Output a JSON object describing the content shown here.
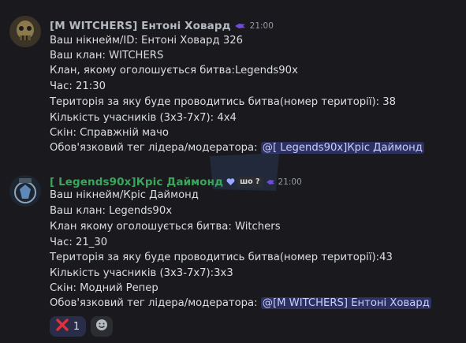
{
  "messages": [
    {
      "username": "[M WITCHERS] Ентоні Ховард",
      "username_color": "#b5bac1",
      "time": "21:00",
      "lines": [
        "Ваш нікнейм/ID: Ентоні Ховард 326",
        "Ваш клан: WITCHERS",
        "Клан, якому оголошується битва:Legends90x",
        "Час: 21:30",
        "Територія за яку буде проводитись битва(номер території): 38",
        "Кількість учасників (3х3-7х7): 4х4",
        "Скін:  Справжній мачо"
      ],
      "tag_line": {
        "prefix": "Обов'язковий тег лідера/модератора: ",
        "mention": "@[ Legends90x]Кріс Даймонд"
      }
    },
    {
      "username": "[ Legends90x]Кріс Даймонд",
      "username_color": "#3ba55c",
      "role_pill": "шо ?",
      "time": "21:00",
      "lines": [
        "Ваш нікнейм/Кріс Даймонд",
        "Ваш клан: Legends90x",
        "Клан якому оголошується битва: Witchers",
        "Час: 21_30",
        "Територія за яку буде проводитись битва(номер території):43",
        "Кількість учасників (3х3-7х7):3х3",
        "Скін: Модний Репер"
      ],
      "tag_line": {
        "prefix": "Обов'язковий тег лідера/модератора: ",
        "mention": "@[M WITCHERS] Ентоні Ховард"
      }
    }
  ],
  "reactions": [
    {
      "emoji": "cross-mark",
      "count": "1"
    }
  ],
  "add_reaction": {
    "icon": "smiley-add-icon"
  },
  "colors": {
    "background": "#1a1a1e",
    "mention_bg": "#3c4270",
    "mention_text": "#c9cdfb",
    "legends_green": "#3ba55c"
  }
}
